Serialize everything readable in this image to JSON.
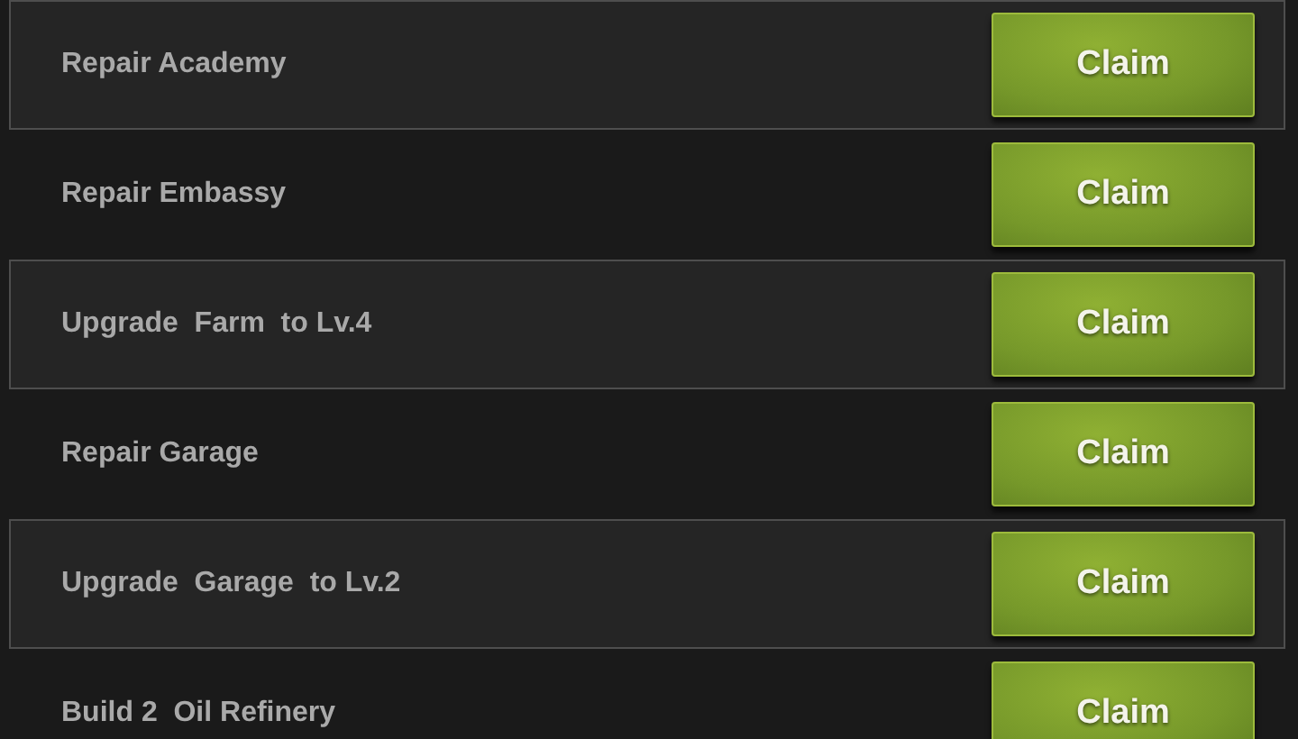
{
  "tasks": [
    {
      "label": "Repair Academy",
      "button": "Claim"
    },
    {
      "label": "Repair Embassy",
      "button": "Claim"
    },
    {
      "label": "Upgrade  Farm  to Lv.4",
      "button": "Claim"
    },
    {
      "label": "Repair Garage",
      "button": "Claim"
    },
    {
      "label": "Upgrade  Garage  to Lv.2",
      "button": "Claim"
    },
    {
      "label": "Build 2  Oil Refinery",
      "button": "Claim"
    }
  ]
}
